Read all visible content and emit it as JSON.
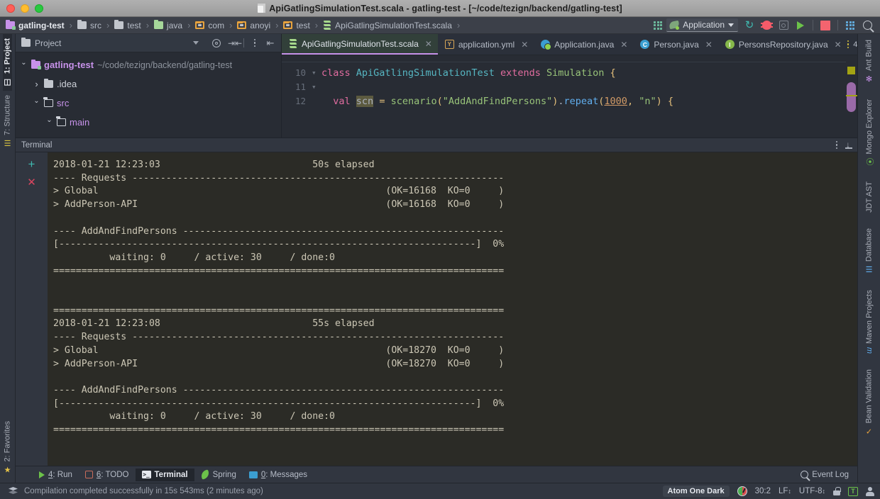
{
  "titlebar": {
    "title": "ApiGatlingSimulationTest.scala - gatling-test - [~/code/tezign/backend/gatling-test]",
    "buttons": [
      "close",
      "minimize",
      "zoom"
    ]
  },
  "navbar": {
    "breadcrumbs": [
      {
        "label": "gatling-test",
        "icon": "module-folder-icon"
      },
      {
        "label": "src",
        "icon": "folder-icon"
      },
      {
        "label": "test",
        "icon": "folder-icon"
      },
      {
        "label": "java",
        "icon": "source-folder-icon"
      },
      {
        "label": "com",
        "icon": "package-folder-icon"
      },
      {
        "label": "anoyi",
        "icon": "package-folder-icon"
      },
      {
        "label": "test",
        "icon": "package-folder-icon"
      },
      {
        "label": "ApiGatlingSimulationTest.scala",
        "icon": "scala-file-icon"
      }
    ],
    "separator": "›",
    "run_config": "Application",
    "actions": [
      "grid-apps-icon",
      "reload-icon",
      "debug-icon",
      "profile-icon",
      "run-icon",
      "stop-icon",
      "layout-icon",
      "search-icon"
    ]
  },
  "left_strip": {
    "top": [
      {
        "label": "1: Project",
        "active": true,
        "icon": "project-icon"
      },
      {
        "label": "7: Structure",
        "active": false,
        "icon": "structure-icon"
      }
    ],
    "bottom": [
      {
        "label": "2: Favorites",
        "active": false,
        "icon": "star-icon"
      }
    ]
  },
  "right_strip": {
    "items": [
      {
        "label": "Ant Build",
        "icon": "ant-icon"
      },
      {
        "label": "Mongo Explorer",
        "icon": "leaf-icon"
      },
      {
        "label": "JDT AST",
        "icon": "none"
      },
      {
        "label": "Database",
        "icon": "database-icon"
      },
      {
        "label": "Maven Projects",
        "icon": "maven-icon"
      },
      {
        "label": "Bean Validation",
        "icon": "validation-icon"
      }
    ]
  },
  "project_panel": {
    "title": "Project",
    "toolbar": [
      "locate-icon",
      "collapse-all-icon",
      "options-kebab-icon",
      "hide-panel-icon"
    ],
    "tree": [
      {
        "indent": 0,
        "arrow": "down",
        "icon": "module-icon",
        "name": "gatling-test",
        "path": "~/code/tezign/backend/gatling-test",
        "bold": true
      },
      {
        "indent": 1,
        "arrow": "right",
        "icon": "folder-icon",
        "name": ".idea",
        "path": "",
        "bold": false
      },
      {
        "indent": 1,
        "arrow": "down",
        "icon": "folder-outline-icon",
        "name": "src",
        "path": "",
        "bold": false
      },
      {
        "indent": 2,
        "arrow": "down",
        "icon": "folder-outline-icon",
        "name": "main",
        "path": "",
        "bold": false
      }
    ]
  },
  "editor": {
    "tabs": [
      {
        "label": "ApiGatlingSimulationTest.scala",
        "icon": "scala-file-icon",
        "active": true
      },
      {
        "label": "application.yml",
        "icon": "yaml-file-icon",
        "active": false
      },
      {
        "label": "Application.java",
        "icon": "spring-class-icon",
        "active": false
      },
      {
        "label": "Person.java",
        "icon": "class-icon",
        "active": false
      },
      {
        "label": "PersonsRepository.java",
        "icon": "interface-icon",
        "active": false
      }
    ],
    "tabs_overflow_count": "4",
    "line_numbers": [
      "10",
      "11",
      "12"
    ],
    "code_lines": [
      "class ApiGatlingSimulationTest extends Simulation {",
      "",
      "  val scn = scenario(\"AddAndFindPersons\").repeat(1000, \"n\") {"
    ]
  },
  "terminal": {
    "title": "Terminal",
    "gutter_actions": [
      "new-session-icon",
      "close-session-icon"
    ],
    "header_actions": [
      "options-kebab-icon",
      "scroll-to-end-icon"
    ],
    "output": "2018-01-21 12:23:03                           50s elapsed\n---- Requests ------------------------------------------------------------------\n> Global                                                   (OK=16168  KO=0     )\n> AddPerson-API                                            (OK=16168  KO=0     )\n\n---- AddAndFindPersons ---------------------------------------------------------\n[--------------------------------------------------------------------------]  0%\n          waiting: 0     / active: 30     / done:0\n================================================================================\n\n\n================================================================================\n2018-01-21 12:23:08                           55s elapsed\n---- Requests ------------------------------------------------------------------\n> Global                                                   (OK=18270  KO=0     )\n> AddPerson-API                                            (OK=18270  KO=0     )\n\n---- AddAndFindPersons ---------------------------------------------------------\n[--------------------------------------------------------------------------]  0%\n          waiting: 0     / active: 30     / done:0\n================================================================================"
  },
  "bottom_tabs": {
    "items": [
      {
        "key": "4",
        "label": ": Run",
        "icon": "run-icon",
        "active": false
      },
      {
        "key": "6",
        "label": ": TODO",
        "icon": "todo-icon",
        "active": false
      },
      {
        "key": "",
        "label": "Terminal",
        "icon": "terminal-icon",
        "active": true
      },
      {
        "key": "",
        "label": "Spring",
        "icon": "spring-icon",
        "active": false
      },
      {
        "key": "0",
        "label": ": Messages",
        "icon": "messages-icon",
        "active": false
      }
    ],
    "event_log": "Event Log"
  },
  "statusbar": {
    "message": "Compilation completed successfully in 15s 543ms (2 minutes ago)",
    "theme": "Atom One Dark",
    "caret_position": "30:2",
    "line_separator": "LF",
    "encoding": "UTF-8",
    "indicators": [
      "gauge-icon",
      "lock-icon",
      "twitter-badge-icon",
      "user-icon"
    ]
  }
}
